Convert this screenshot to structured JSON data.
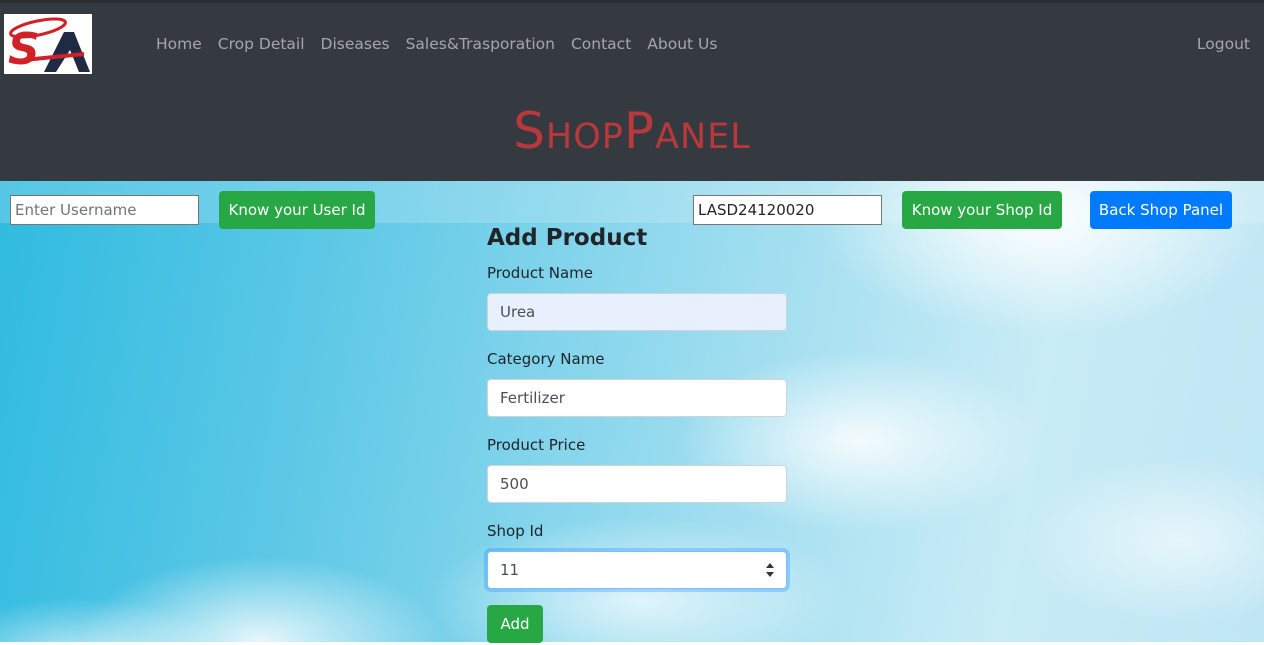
{
  "nav": {
    "links": [
      "Home",
      "Crop Detail",
      "Diseases",
      "Sales&Trasporation",
      "Contact",
      "About Us"
    ],
    "logout": "Logout"
  },
  "brand": "ShopPanel",
  "lookup": {
    "username_placeholder": "Enter Username",
    "user_id_button": "Know your User Id",
    "shop_code_value": "LASD24120020",
    "shop_id_button": "Know your Shop Id",
    "back_button": "Back Shop Panel"
  },
  "form": {
    "title": "Add Product",
    "product_name_label": "Product Name",
    "product_name_value": "Urea",
    "category_label": "Category Name",
    "category_value": "Fertilizer",
    "price_label": "Product Price",
    "price_value": "500",
    "shop_id_label": "Shop Id",
    "shop_id_value": "11",
    "submit_label": "Add"
  },
  "colors": {
    "navbar": "#343a40",
    "brand": "#d9383c",
    "success": "#28a745",
    "primary": "#007bff"
  }
}
